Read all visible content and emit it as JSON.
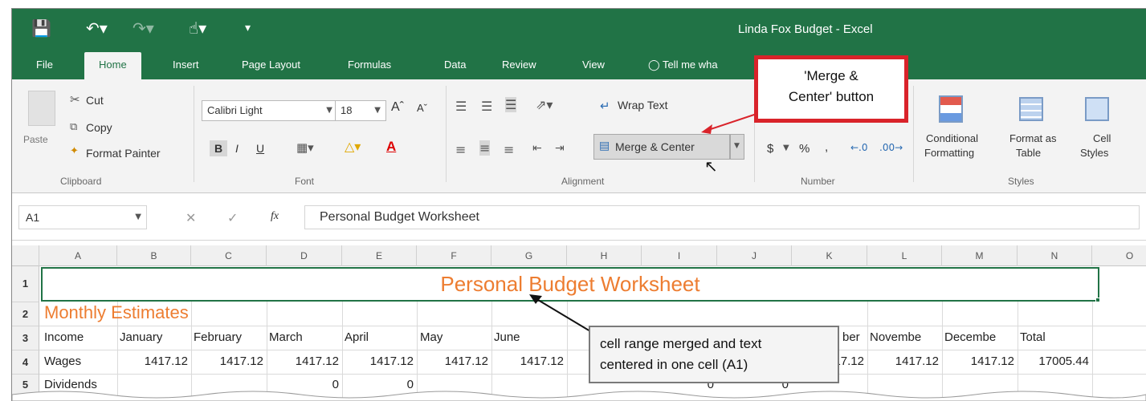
{
  "titlebar": {
    "title": "Linda Fox Budget - Excel",
    "quick_access": [
      "save-icon",
      "undo-icon",
      "redo-icon",
      "touch-mode-icon",
      "customize-icon"
    ]
  },
  "tabs": [
    "File",
    "Home",
    "Insert",
    "Page Layout",
    "Formulas",
    "Data",
    "Review",
    "View",
    "Tell me wha"
  ],
  "ribbon": {
    "clipboard": {
      "paste": "Paste",
      "cut": "Cut",
      "copy": "Copy",
      "format_painter": "Format Painter",
      "group": "Clipboard"
    },
    "font": {
      "name": "Calibri Light",
      "size": "18",
      "bold": "B",
      "italic": "I",
      "underline": "U",
      "group": "Font"
    },
    "alignment": {
      "wrap_text": "Wrap Text",
      "merge_center": "Merge & Center",
      "group": "Alignment"
    },
    "number": {
      "currency": "$",
      "percent": "%",
      "comma": ",",
      "group": "Number"
    },
    "styles": {
      "conditional": [
        "Conditional",
        "Formatting"
      ],
      "format_table": [
        "Format as",
        "Table"
      ],
      "cell_styles": [
        "Cell",
        "Styles"
      ],
      "group": "Styles"
    }
  },
  "formula_bar": {
    "name_box": "A1",
    "fx": "fx",
    "value": "Personal Budget Worksheet"
  },
  "columns": [
    "A",
    "B",
    "C",
    "D",
    "E",
    "F",
    "G",
    "H",
    "I",
    "J",
    "K",
    "L",
    "M",
    "N",
    "O"
  ],
  "rows": [
    {
      "n": "1"
    },
    {
      "n": "2"
    },
    {
      "n": "3"
    },
    {
      "n": "4"
    },
    {
      "n": "5"
    }
  ],
  "sheet": {
    "a1": "Personal Budget Worksheet",
    "a2": "Monthly Estimates",
    "row3": [
      "Income",
      "January",
      "February",
      "March",
      "April",
      "May",
      "June",
      "",
      "",
      "",
      "ber",
      "Novembe",
      "Decembe",
      "Total"
    ],
    "row4": [
      "Wages",
      "1417.12",
      "1417.12",
      "1417.12",
      "1417.12",
      "1417.12",
      "1417.12",
      "",
      "",
      "",
      "17.12",
      "1417.12",
      "1417.12",
      "17005.44"
    ],
    "row5": [
      "Dividends",
      "",
      "",
      "0",
      "0",
      "",
      "",
      "",
      "0",
      "0",
      "",
      "",
      "",
      ""
    ]
  },
  "callouts": {
    "merge": [
      "'Merge &",
      "Center' button"
    ],
    "merged": [
      "cell range merged and text",
      "centered in one cell (A1)"
    ]
  },
  "colors": {
    "excel_green": "#217346",
    "heading_orange": "#ed7d31",
    "callout_red": "#d9232a"
  }
}
